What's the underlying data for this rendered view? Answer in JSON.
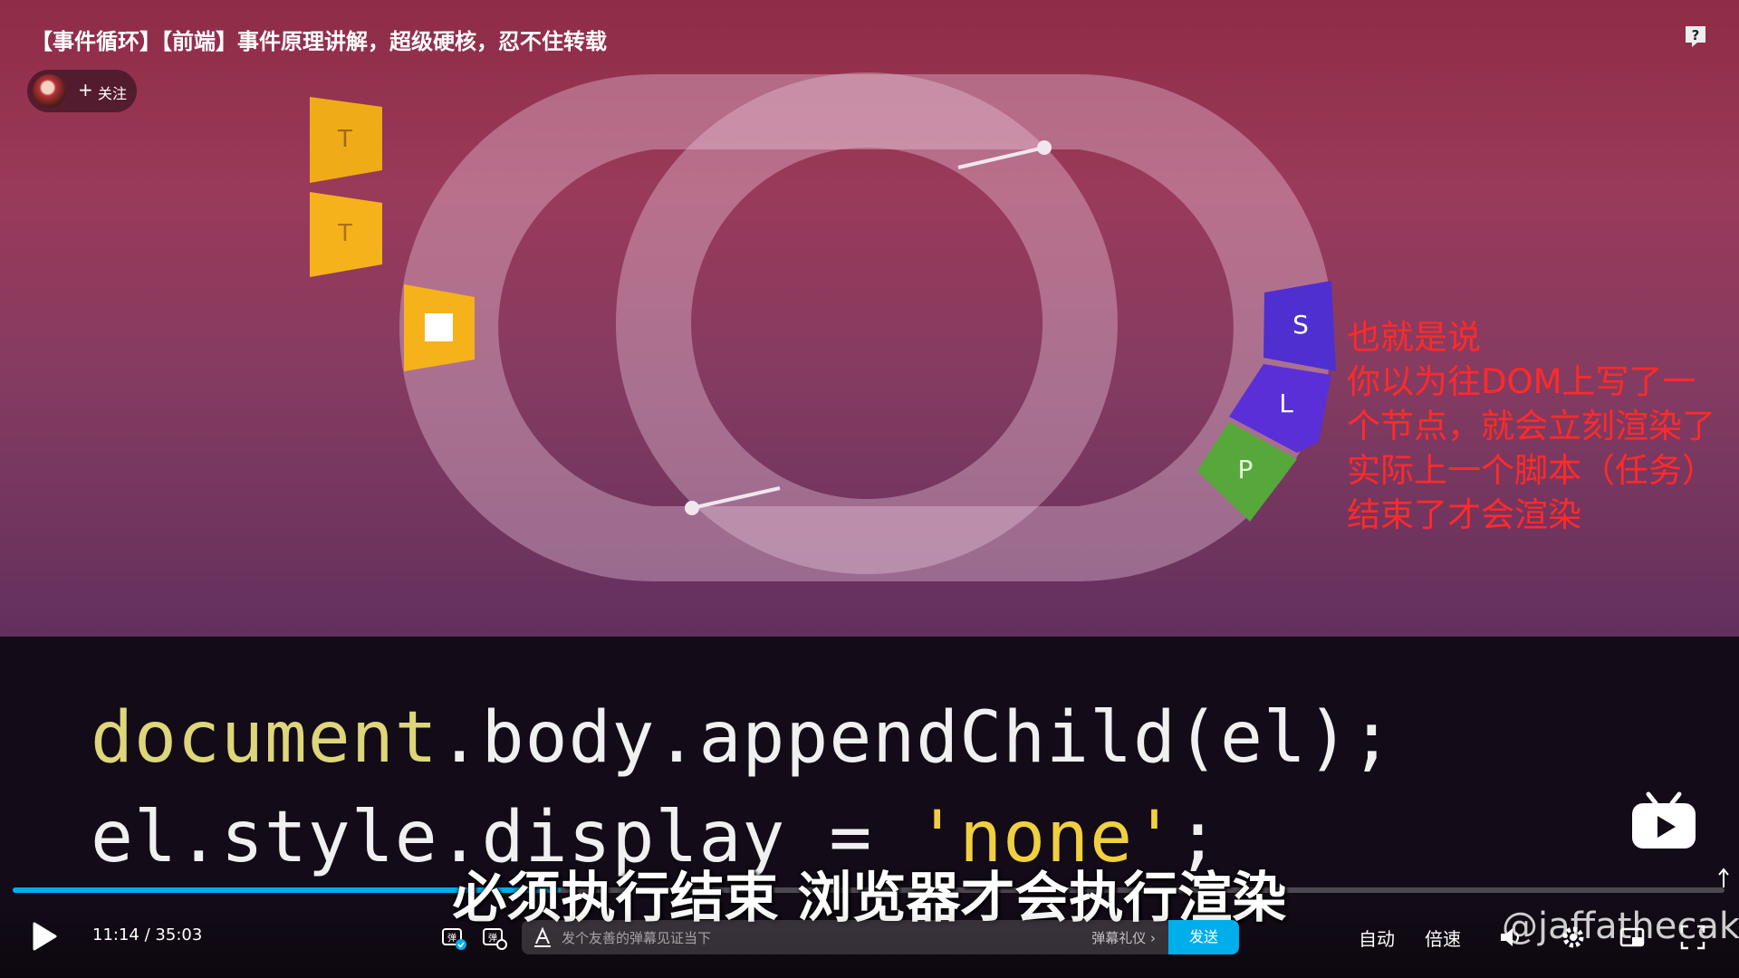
{
  "video": {
    "title": "【事件循环】【前端】事件原理讲解，超级硬核，忍不住转载",
    "follow_label": "关注",
    "follow_plus": "+",
    "subtitle": "必须执行结束 浏览器才会执行渲染",
    "annotation_lines": [
      "也就是说",
      "你以为往DOM上写了一",
      "个节点，就会立刻渲染了",
      "实际上一个脚本（任务）",
      "结束了才会渲染"
    ],
    "watermark": "@jaffathecake"
  },
  "diagram": {
    "task_labels": [
      "T",
      "T"
    ],
    "render_steps": [
      "S",
      "L",
      "P"
    ]
  },
  "code": {
    "line1_obj": "document",
    "line1_rest": ".body.appendChild(el);",
    "line2_pre": "el.style.display = ",
    "line2_str": "'none'",
    "line2_end": ";"
  },
  "player": {
    "current_time": "11:14",
    "separator": "/",
    "duration": "35:03",
    "progress_fraction": 0.32,
    "danmaku_placeholder": "发个友善的弹幕见证当下",
    "danmaku_etiquette": "弹幕礼仪",
    "send_label": "发送",
    "auto_label": "自动",
    "speed_label": "倍速"
  },
  "colors": {
    "accent": "#00aeec",
    "annotation": "#ff2a2a",
    "task_yellow": "#f6b21b",
    "render_purple": "#5b2fd6",
    "paint_green": "#56a83a"
  }
}
